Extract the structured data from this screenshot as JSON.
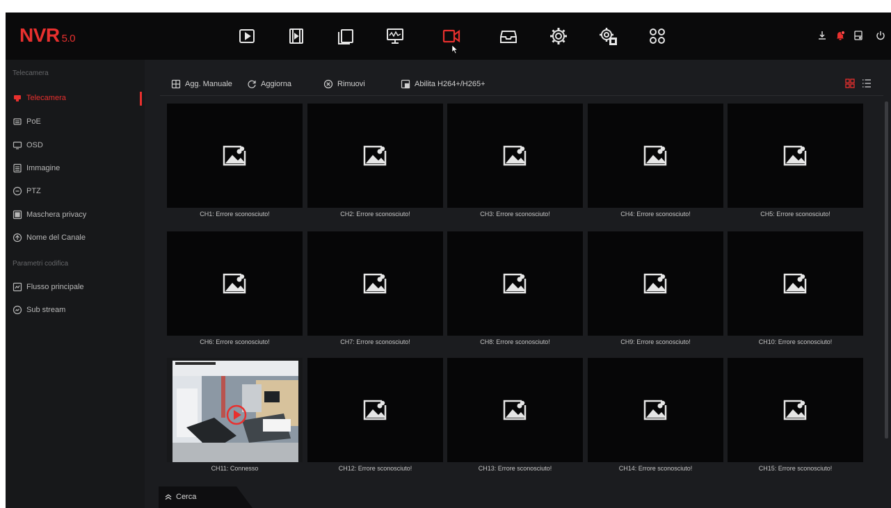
{
  "app": {
    "logo": "NVR",
    "version": "5.0",
    "accent": "#e8302e"
  },
  "topnav": [
    {
      "icon": "playback-icon"
    },
    {
      "icon": "video-clips-icon"
    },
    {
      "icon": "files-icon"
    },
    {
      "icon": "system-monitor-icon"
    },
    {
      "icon": "camera-icon",
      "active": true
    },
    {
      "icon": "inbox-icon"
    },
    {
      "icon": "settings-gear-icon"
    },
    {
      "icon": "advanced-settings-icon"
    },
    {
      "icon": "apps-grid-icon"
    }
  ],
  "tray": [
    {
      "icon": "download-icon"
    },
    {
      "icon": "alarm-notification-icon"
    },
    {
      "icon": "disk-icon"
    },
    {
      "icon": "power-icon"
    }
  ],
  "sidebar": {
    "section1": "Telecamera",
    "items1": [
      {
        "label": "Telecamera",
        "icon": "camera-icon",
        "active": true
      },
      {
        "label": "PoE",
        "icon": "poe-icon"
      },
      {
        "label": "OSD",
        "icon": "monitor-icon"
      },
      {
        "label": "Immagine",
        "icon": "image-settings-icon"
      },
      {
        "label": "PTZ",
        "icon": "ptz-icon"
      },
      {
        "label": "Maschera privacy",
        "icon": "privacy-mask-icon"
      },
      {
        "label": "Nome del Canale",
        "icon": "channel-name-icon"
      }
    ],
    "section2": "Parametri codifica",
    "items2": [
      {
        "label": "Flusso principale",
        "icon": "main-stream-icon"
      },
      {
        "label": "Sub stream",
        "icon": "sub-stream-icon"
      }
    ]
  },
  "toolbar": {
    "add_manual": "Agg. Manuale",
    "refresh": "Aggiorna",
    "remove": "Rimuovi",
    "enable_codec": "Abilita H264+/H265+"
  },
  "channels": [
    {
      "caption": "CH1: Errore sconosciuto!",
      "live": false
    },
    {
      "caption": "CH2: Errore sconosciuto!",
      "live": false
    },
    {
      "caption": "CH3: Errore sconosciuto!",
      "live": false
    },
    {
      "caption": "CH4: Errore sconosciuto!",
      "live": false
    },
    {
      "caption": "CH5: Errore sconosciuto!",
      "live": false
    },
    {
      "caption": "CH6: Errore sconosciuto!",
      "live": false
    },
    {
      "caption": "CH7: Errore sconosciuto!",
      "live": false
    },
    {
      "caption": "CH8: Errore sconosciuto!",
      "live": false
    },
    {
      "caption": "CH9: Errore sconosciuto!",
      "live": false
    },
    {
      "caption": "CH10: Errore sconosciuto!",
      "live": false
    },
    {
      "caption": "CH11: Connesso",
      "live": true
    },
    {
      "caption": "CH12: Errore sconosciuto!",
      "live": false
    },
    {
      "caption": "CH13: Errore sconosciuto!",
      "live": false
    },
    {
      "caption": "CH14: Errore sconosciuto!",
      "live": false
    },
    {
      "caption": "CH15: Errore sconosciuto!",
      "live": false
    }
  ],
  "bottom": {
    "search_label": "Cerca"
  }
}
